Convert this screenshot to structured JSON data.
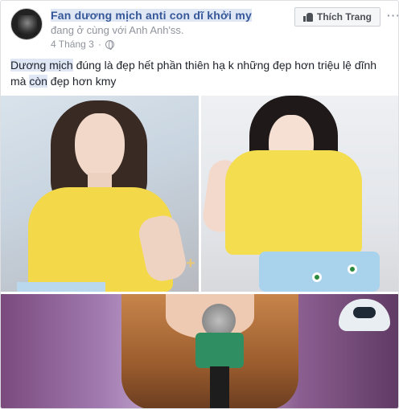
{
  "post": {
    "page_name": "Fan dương mịch anti con dĩ khởi my",
    "tagline_prefix": "đang ở cùng với",
    "tagged_friend": "Anh Anh'ss.",
    "date": "4 Tháng 3",
    "date_separator": "·",
    "like_label": "Thích Trang",
    "menu_label": "···",
    "text_highlight": "Dương mịch",
    "text_part1": " đúng là đẹp hết phần thiên hạ k những đẹp hơn triệu lệ dĩnh mà ",
    "text_highlight2": "còn",
    "text_part2": " đẹp hơn kmy"
  },
  "icons": {
    "avatar": "page-avatar",
    "globe": "globe-icon",
    "like": "thumb-up-icon",
    "menu": "more-options-icon"
  },
  "colors": {
    "link": "#365899",
    "meta": "#90949c",
    "highlight": "#dfe7f5",
    "shirt": "#f3d94a"
  }
}
